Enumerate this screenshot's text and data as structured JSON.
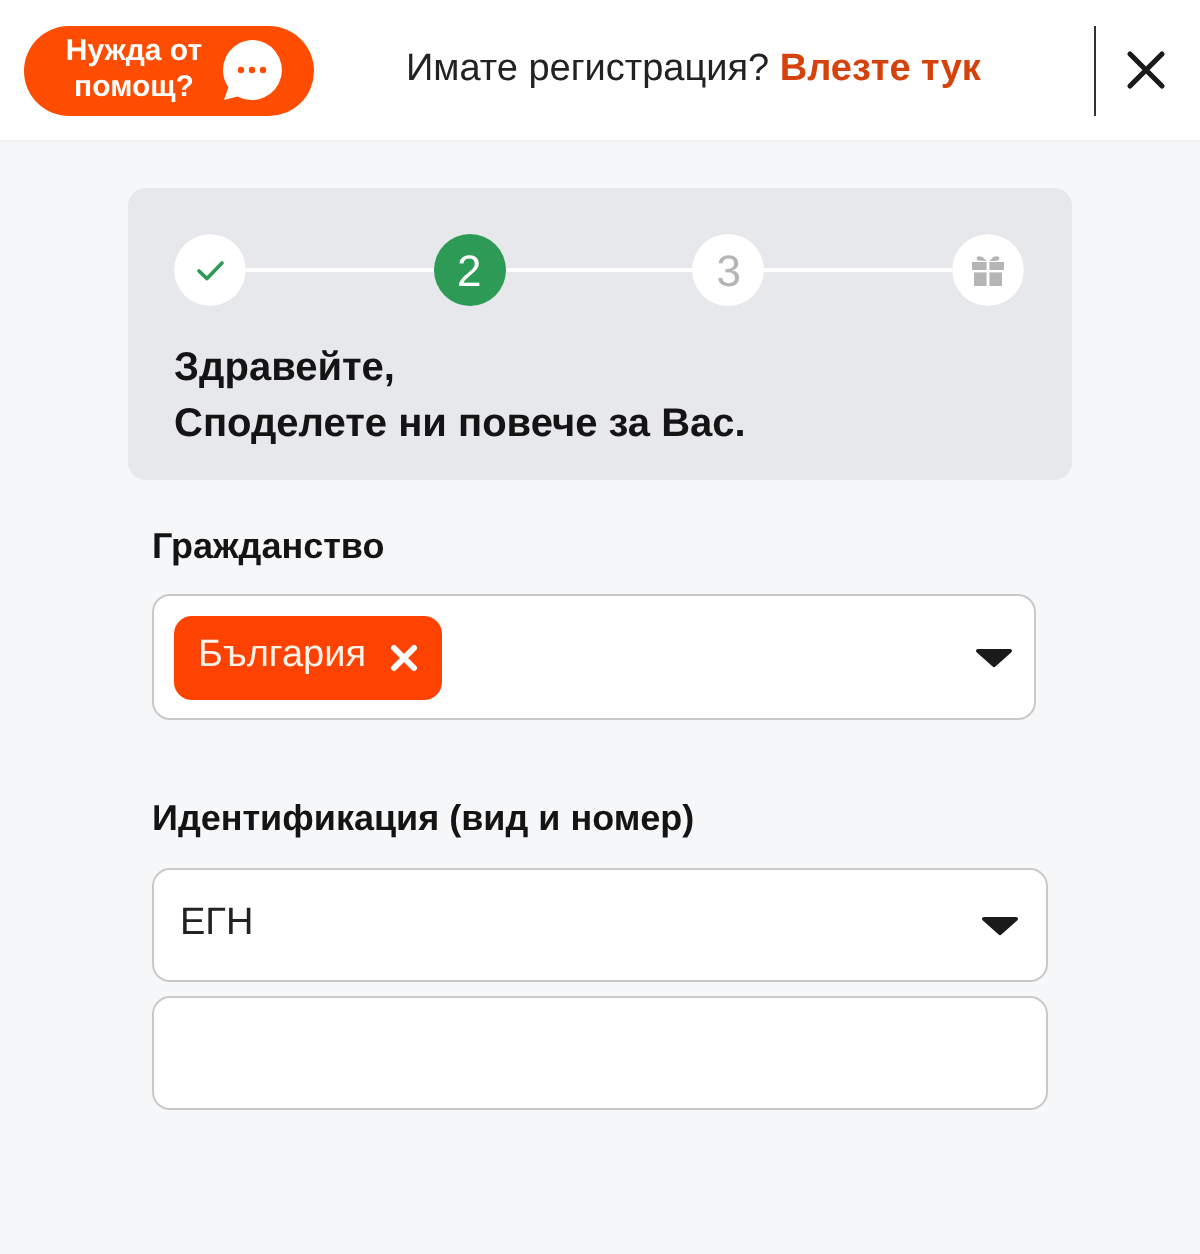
{
  "header": {
    "help_button": {
      "label": "Нужда от помощ?"
    },
    "login_prompt": "Имате регистрация?",
    "login_link": "Влезте тук"
  },
  "steps": [
    {
      "kind": "done",
      "selected": false
    },
    {
      "kind": "number",
      "label": "2",
      "selected": true
    },
    {
      "kind": "number",
      "label": "3",
      "selected": false
    },
    {
      "kind": "gift",
      "selected": false
    }
  ],
  "heading": [
    "Здравейте,",
    "Споделете ни повече за Вас."
  ],
  "fields": [
    {
      "kind": "multiselect",
      "label": "Гражданство",
      "chips": [
        {
          "label": "България"
        }
      ]
    },
    {
      "kind": "group",
      "label": "Идентификация (вид и номер)",
      "controls": [
        {
          "kind": "select",
          "value": "ЕГН"
        },
        {
          "kind": "input"
        }
      ]
    }
  ]
}
